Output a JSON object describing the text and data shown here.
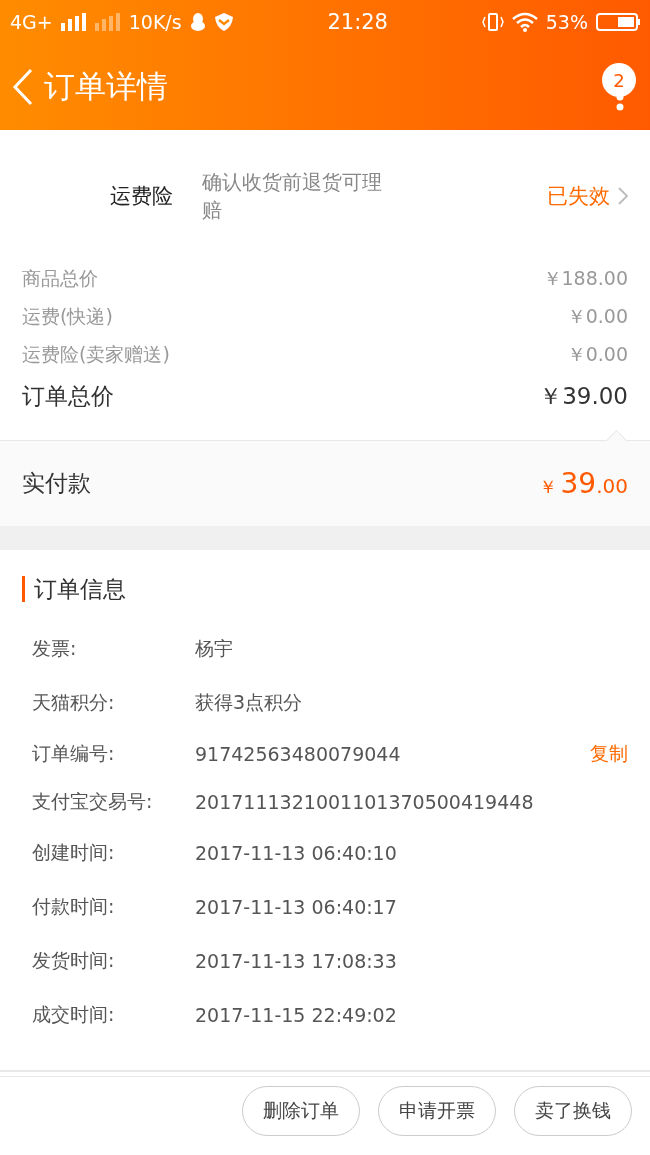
{
  "status_bar": {
    "network": "4G+",
    "speed": "10K/s",
    "time": "21:28",
    "battery": "53%"
  },
  "header": {
    "title": "订单详情",
    "badge": "2"
  },
  "insurance": {
    "label": "运费险",
    "description": "确认收货前退货可理赔",
    "status": "已失效"
  },
  "prices": [
    {
      "label": "商品总价",
      "value": "￥188.00",
      "kind": "minor"
    },
    {
      "label": "运费(快递)",
      "value": "￥0.00",
      "kind": "minor"
    },
    {
      "label": "运费险(卖家赠送)",
      "value": "￥0.00",
      "kind": "minor"
    },
    {
      "label": "订单总价",
      "value": "￥39.00",
      "kind": "total"
    }
  ],
  "paid": {
    "label": "实付款",
    "currency": "￥",
    "integer": "39",
    "decimal": ".00"
  },
  "order_info": {
    "title": "订单信息",
    "rows": [
      {
        "label": "发票:",
        "value": "杨宇"
      },
      {
        "label": "天猫积分:",
        "value": "获得3点积分"
      },
      {
        "label": "订单编号:",
        "value": "91742563480079044",
        "action": "复制"
      },
      {
        "label": "支付宝交易号:",
        "value": "2017111321001101370500419448"
      },
      {
        "label": "创建时间:",
        "value": "2017-11-13 06:40:10"
      },
      {
        "label": "付款时间:",
        "value": "2017-11-13 06:40:17"
      },
      {
        "label": "发货时间:",
        "value": "2017-11-13 17:08:33"
      },
      {
        "label": "成交时间:",
        "value": "2017-11-15 22:49:02"
      }
    ]
  },
  "buttons": [
    "删除订单",
    "申请开票",
    "卖了换钱"
  ]
}
